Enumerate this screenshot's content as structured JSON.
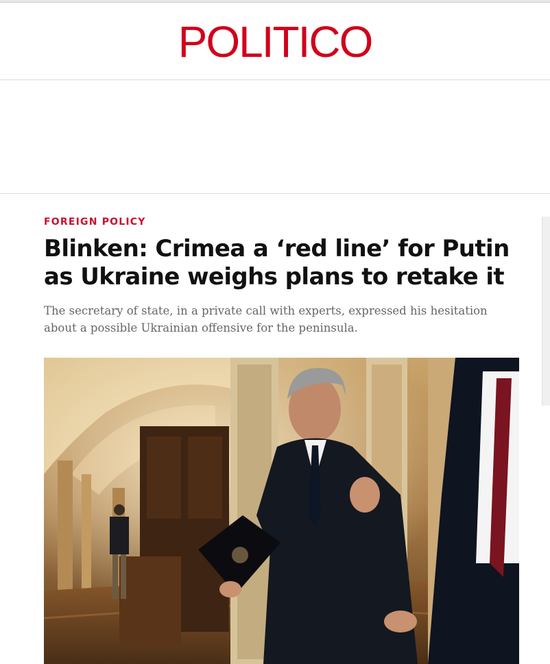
{
  "masthead": {
    "logo_text": "POLITICO",
    "logo_color": "#d0021b"
  },
  "article": {
    "kicker": "FOREIGN POLICY",
    "kicker_color": "#c8102e",
    "headline": "Blinken: Crimea a ‘red line’ for Putin as Ukraine weighs plans to retake it",
    "dek": "The secretary of state, in a private call with experts, expressed his hesitation about a possible Ukrainian offensive for the peninsula."
  },
  "lead_image": {
    "subject": "photo-of-man-in-suit-walking-in-capitol-corridor"
  }
}
